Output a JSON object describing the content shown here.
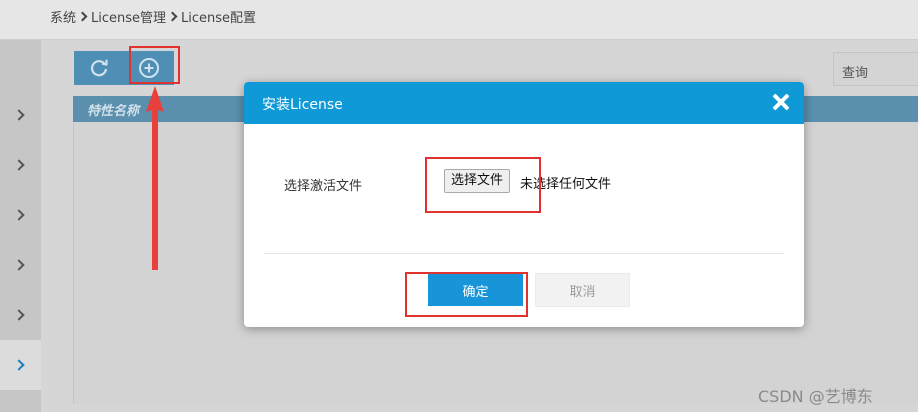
{
  "breadcrumb": [
    "系统",
    "License管理",
    "License配置"
  ],
  "toolbar": {
    "refresh_icon": "refresh-icon",
    "add_icon": "add-circle-icon",
    "search_label": "查询"
  },
  "grid": {
    "columns": [
      "特性名称"
    ]
  },
  "sidebar": {
    "item_count": 6,
    "active_index": 5
  },
  "dialog": {
    "title": "安装License",
    "field_label": "选择激活文件",
    "file_button": "选择文件",
    "file_status": "未选择任何文件",
    "ok_label": "确定",
    "cancel_label": "取消"
  },
  "watermark": "CSDN @艺博东",
  "colors": {
    "accent": "#0f9ad7",
    "highlight": "#e0322f"
  }
}
